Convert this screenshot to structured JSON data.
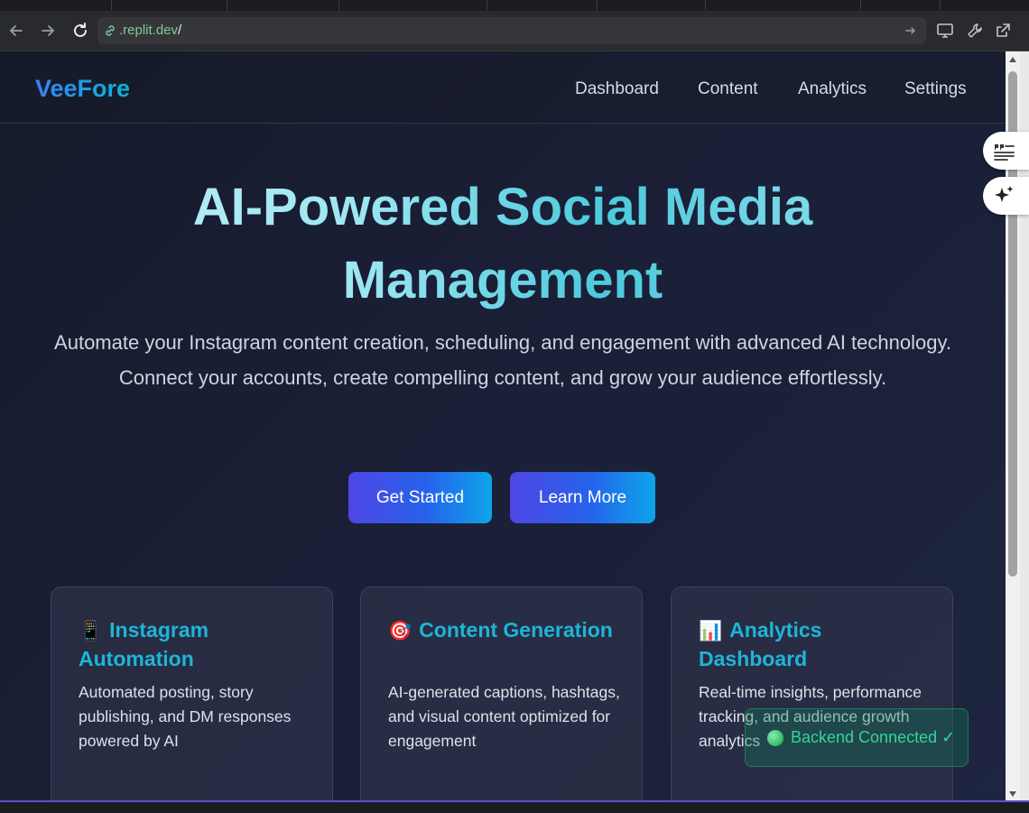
{
  "browser": {
    "url_host": ".replit.dev",
    "url_path": "/"
  },
  "site": {
    "logo": "VeeFore",
    "nav": [
      "Dashboard",
      "Content",
      "Analytics",
      "Settings"
    ]
  },
  "hero": {
    "title_line1": "AI-Powered Social Media",
    "title_line2": "Management",
    "subtitle": "Automate your Instagram content creation, scheduling, and engagement with advanced AI technology. Connect your accounts, create compelling content, and grow your audience effortlessly.",
    "primary_button": "Get Started",
    "secondary_button": "Learn More"
  },
  "features": [
    {
      "emoji": "📱",
      "title": "Instagram Automation",
      "desc": "Automated posting, story publishing, and DM responses powered by AI"
    },
    {
      "emoji": "🎯",
      "title": "Content Generation",
      "desc": "AI-generated captions, hashtags, and visual content optimized for engagement"
    },
    {
      "emoji": "📊",
      "title": "Analytics Dashboard",
      "desc": "Real-time insights, performance tracking, and audience growth analytics"
    }
  ],
  "status_toast": "Backend Connected ✓",
  "icons": {
    "side_fab_top": "quote-list-icon",
    "side_fab_bottom": "sparkle-icon"
  }
}
